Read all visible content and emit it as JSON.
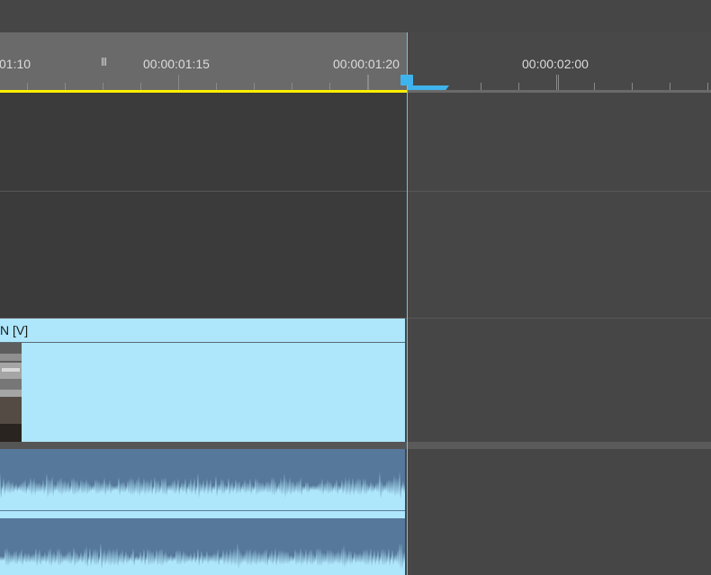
{
  "ruler": {
    "timecodes": [
      "01:10",
      "00:00:01:15",
      "00:00:01:20",
      "00:00:02:00"
    ]
  },
  "clip": {
    "label": "N [V]"
  },
  "colors": {
    "work_area_bar": "#ffee00",
    "playhead": "#3fb4ec",
    "video_clip": "#aee6fb",
    "audio_clip": "#56789a"
  },
  "icons": {
    "marker": "marker-icon",
    "playhead": "playhead-handle-icon"
  }
}
